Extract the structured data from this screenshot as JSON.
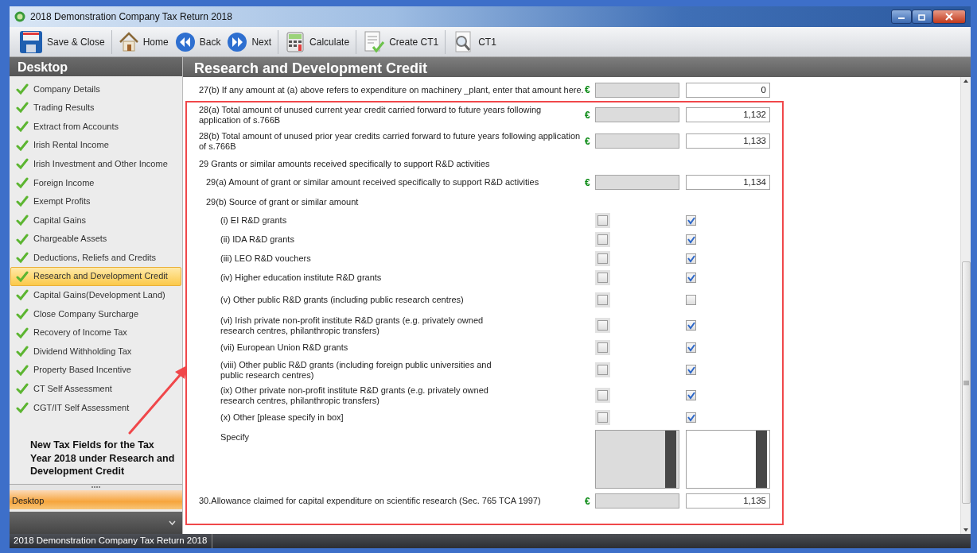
{
  "window": {
    "title": "2018 Demonstration Company Tax Return 2018"
  },
  "toolbar": [
    [
      {
        "label": "Save & Close",
        "kind": "save"
      }
    ],
    [
      {
        "label": "Home",
        "kind": "home"
      },
      {
        "label": "Back",
        "kind": "back"
      },
      {
        "label": "Next",
        "kind": "next"
      }
    ],
    [
      {
        "label": "Calculate",
        "kind": "calculate"
      }
    ],
    [
      {
        "label": "Create CT1",
        "kind": "create"
      }
    ],
    [
      {
        "label": "CT1",
        "kind": "view"
      }
    ]
  ],
  "sidebar": {
    "title": "Desktop",
    "items": [
      {
        "label": "Company Details",
        "done": true,
        "selected": false
      },
      {
        "label": "Trading Results",
        "done": true,
        "selected": false
      },
      {
        "label": "Extract from Accounts",
        "done": true,
        "selected": false
      },
      {
        "label": "Irish Rental Income",
        "done": true,
        "selected": false
      },
      {
        "label": "Irish Investment and Other Income",
        "done": true,
        "selected": false
      },
      {
        "label": "Foreign Income",
        "done": true,
        "selected": false
      },
      {
        "label": "Exempt Profits",
        "done": true,
        "selected": false
      },
      {
        "label": "Capital Gains",
        "done": true,
        "selected": false
      },
      {
        "label": "Chargeable Assets",
        "done": true,
        "selected": false
      },
      {
        "label": "Deductions, Reliefs and Credits",
        "done": true,
        "selected": false
      },
      {
        "label": "Research and Development Credit",
        "done": true,
        "selected": true
      },
      {
        "label": "Capital Gains(Development Land)",
        "done": true,
        "selected": false
      },
      {
        "label": "Close Company Surcharge",
        "done": true,
        "selected": false
      },
      {
        "label": "Recovery of Income Tax",
        "done": true,
        "selected": false
      },
      {
        "label": "Dividend Withholding Tax",
        "done": true,
        "selected": false
      },
      {
        "label": "Property Based Incentive",
        "done": true,
        "selected": false
      },
      {
        "label": "CT Self Assessment",
        "done": true,
        "selected": false
      },
      {
        "label": "CGT/IT Self Assessment",
        "done": true,
        "selected": false
      }
    ],
    "annotation": "New Tax Fields for the Tax Year 2018 under Research and Development Credit",
    "pane_button": "Desktop"
  },
  "page": {
    "title": "Research and Development Credit",
    "rows": [
      {
        "kind": "amount",
        "label": "27(b) If any amount at (a) above refers to expenditure on machinery _plant, enter that amount here.",
        "currency": "€",
        "value": "0"
      }
    ],
    "highlighted_rows": [
      {
        "kind": "amount",
        "label": "28(a) Total amount of unused current year credit carried forward to future years following application of s.766B",
        "currency": "€",
        "value": "1,132"
      },
      {
        "kind": "amount",
        "label": "28(b) Total amount of unused prior year credits carried forward to future years following application of s.766B",
        "currency": "€",
        "value": "1,133"
      },
      {
        "kind": "heading",
        "label": "29 Grants or similar amounts received specifically to support R&D activities",
        "children": [
          {
            "kind": "amount",
            "label": "29(a) Amount of grant or similar amount received specifically to support R&D activities",
            "currency": "€",
            "value": "1,134"
          },
          {
            "kind": "heading",
            "label": "29(b) Source of grant or similar amount",
            "children": [
              {
                "kind": "checkbox",
                "label": "(i) EI R&D grants",
                "boxes": [
                  {
                    "checked": false,
                    "disabled": true
                  },
                  {
                    "checked": true,
                    "disabled": false
                  }
                ]
              },
              {
                "kind": "checkbox",
                "label": "(ii) IDA R&D grants",
                "boxes": [
                  {
                    "checked": false,
                    "disabled": true
                  },
                  {
                    "checked": true,
                    "disabled": false
                  }
                ]
              },
              {
                "kind": "checkbox",
                "label": "(iii) LEO R&D vouchers",
                "boxes": [
                  {
                    "checked": false,
                    "disabled": true
                  },
                  {
                    "checked": true,
                    "disabled": false
                  }
                ]
              },
              {
                "kind": "checkbox",
                "label": "(iv) Higher education institute R&D grants",
                "boxes": [
                  {
                    "checked": false,
                    "disabled": true
                  },
                  {
                    "checked": true,
                    "disabled": false
                  }
                ]
              },
              {
                "kind": "checkbox",
                "label": "(v) Other public R&D grants (including public research centres)",
                "boxes": [
                  {
                    "checked": false,
                    "disabled": true
                  },
                  {
                    "checked": false,
                    "disabled": false
                  }
                ]
              },
              {
                "kind": "checkbox",
                "label": "(vi) Irish private non-profit institute R&D grants (e.g. privately owned research centres, philanthropic transfers)",
                "boxes": [
                  {
                    "checked": false,
                    "disabled": true
                  },
                  {
                    "checked": true,
                    "disabled": false
                  }
                ]
              },
              {
                "kind": "checkbox",
                "label": "(vii) European Union R&D grants",
                "boxes": [
                  {
                    "checked": false,
                    "disabled": true
                  },
                  {
                    "checked": true,
                    "disabled": false
                  }
                ]
              },
              {
                "kind": "checkbox",
                "label": "(viii) Other public R&D grants (including foreign public universities and public research centres)",
                "boxes": [
                  {
                    "checked": false,
                    "disabled": true
                  },
                  {
                    "checked": true,
                    "disabled": false
                  }
                ]
              },
              {
                "kind": "checkbox",
                "label": "(ix) Other private non-profit institute R&D grants (e.g. privately owned research centres, philanthropic transfers)",
                "boxes": [
                  {
                    "checked": false,
                    "disabled": true
                  },
                  {
                    "checked": true,
                    "disabled": false
                  }
                ]
              },
              {
                "kind": "checkbox",
                "label": "(x) Other [please specify in box]",
                "boxes": [
                  {
                    "checked": false,
                    "disabled": true
                  },
                  {
                    "checked": true,
                    "disabled": false
                  }
                ]
              },
              {
                "kind": "text",
                "label": "Specify"
              }
            ]
          }
        ]
      },
      {
        "kind": "amount",
        "label": "30.Allowance claimed for capital expenditure on scientific research (Sec. 765 TCA 1997)",
        "currency": "€",
        "value": "1,135"
      }
    ]
  },
  "status_bar": "2018 Demonstration Company Tax Return 2018"
}
